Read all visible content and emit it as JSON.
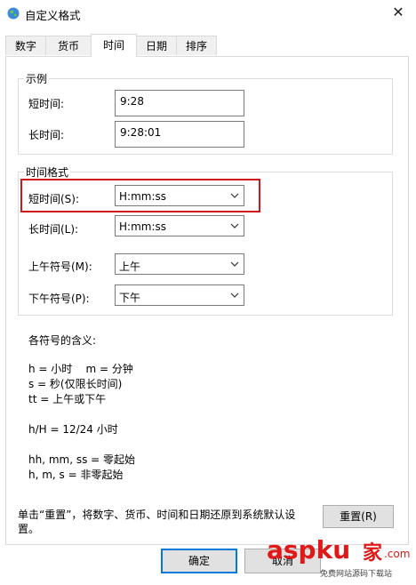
{
  "window": {
    "title": "自定义格式"
  },
  "tabs": [
    {
      "label": "数字"
    },
    {
      "label": "货币"
    },
    {
      "label": "时间"
    },
    {
      "label": "日期"
    },
    {
      "label": "排序"
    }
  ],
  "example": {
    "group_title": "示例",
    "short_label": "短时间:",
    "short_value": "9:28",
    "long_label": "长时间:",
    "long_value": "9:28:01"
  },
  "formats": {
    "group_title": "时间格式",
    "short_label": "短时间(S):",
    "short_value": "H:mm:ss",
    "long_label": "长时间(L):",
    "long_value": "H:mm:ss",
    "am_label": "上午符号(M):",
    "am_value": "上午",
    "pm_label": "下午符号(P):",
    "pm_value": "下午"
  },
  "legend": {
    "heading": "各符号的含义:",
    "line1": "h = 小时    m = 分钟",
    "line2": "s = 秒(仅限长时间)",
    "line3": "tt = 上午或下午",
    "line4": "h/H = 12/24 小时",
    "line5": "hh, mm, ss = 零起始",
    "line6": "h, m, s = 非零起始"
  },
  "reset": {
    "note_line1": "单击“重置”，将数字、货币、时间和日期还原到系统默认设",
    "note_line2": "置。",
    "button_label": "重置(R)"
  },
  "footer": {
    "ok_label": "确定",
    "cancel_label": "取消"
  },
  "watermark": {
    "brand": "aspku",
    "suffix": "家",
    "tld": ".com",
    "tagline": "免费网站源码下载站"
  },
  "colors": {
    "highlight": "#d01818",
    "accent": "#0078d7",
    "watermark": "#e01818"
  }
}
